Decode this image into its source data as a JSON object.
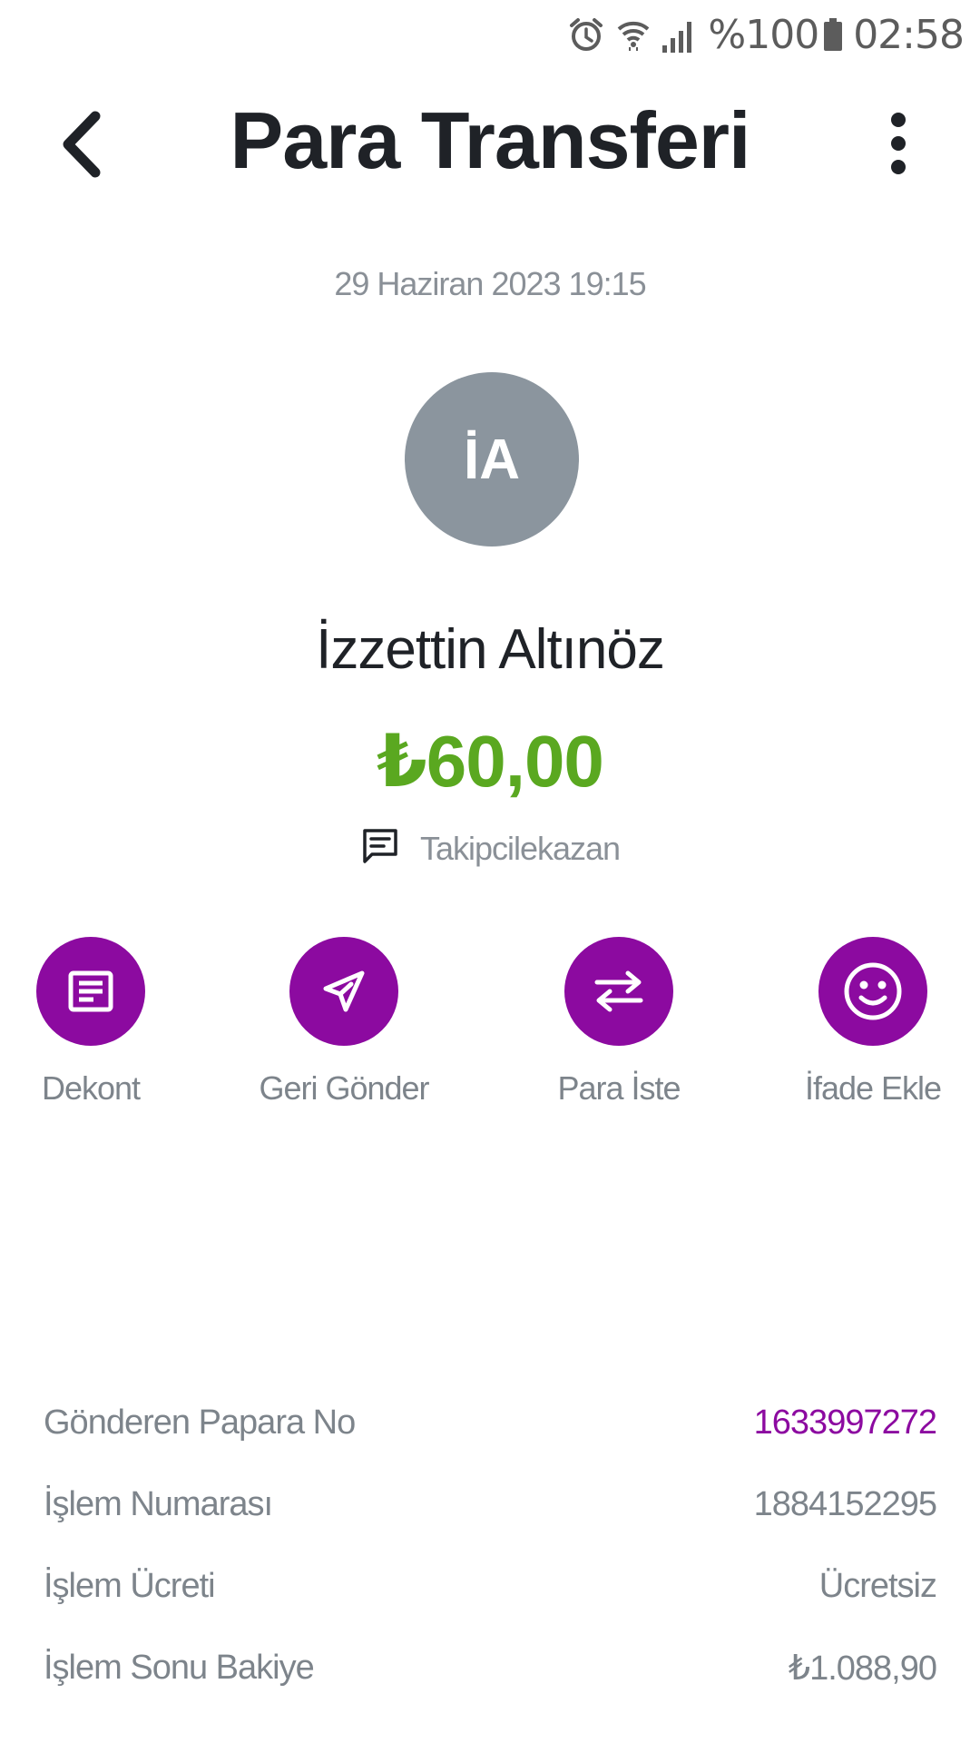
{
  "status_bar": {
    "battery": "%100",
    "time": "02:58",
    "icons": [
      "alarm-icon",
      "wifi-icon",
      "signal-icon",
      "battery-icon"
    ]
  },
  "header": {
    "title": "Para Transferi",
    "back_icon": "chevron-left-icon",
    "menu_icon": "more-vertical-icon"
  },
  "transfer": {
    "datetime": "29 Haziran 2023 19:15",
    "avatar_initials": "İA",
    "recipient_name": "İzzettin Altınöz",
    "amount": "₺60,00",
    "note_icon": "message-icon",
    "note": "Takipcilekazan"
  },
  "actions": [
    {
      "label": "Dekont",
      "icon": "receipt-icon"
    },
    {
      "label": "Geri Gönder",
      "icon": "send-icon"
    },
    {
      "label": "Para İste",
      "icon": "swap-icon"
    },
    {
      "label": "İfade Ekle",
      "icon": "smiley-icon"
    }
  ],
  "details": [
    {
      "label": "Gönderen Papara No",
      "value": "1633997272"
    },
    {
      "label": "İşlem Numarası",
      "value": "1884152295"
    },
    {
      "label": "İşlem Ücreti",
      "value": "Ücretsiz"
    },
    {
      "label": "İşlem Sonu Bakiye",
      "value": "₺1.088,90"
    }
  ],
  "colors": {
    "accent": "#8c0aa0",
    "amount": "#5aa820",
    "avatar_bg": "#8b959e",
    "text_primary": "#1f2227",
    "text_secondary": "#7d848b"
  }
}
